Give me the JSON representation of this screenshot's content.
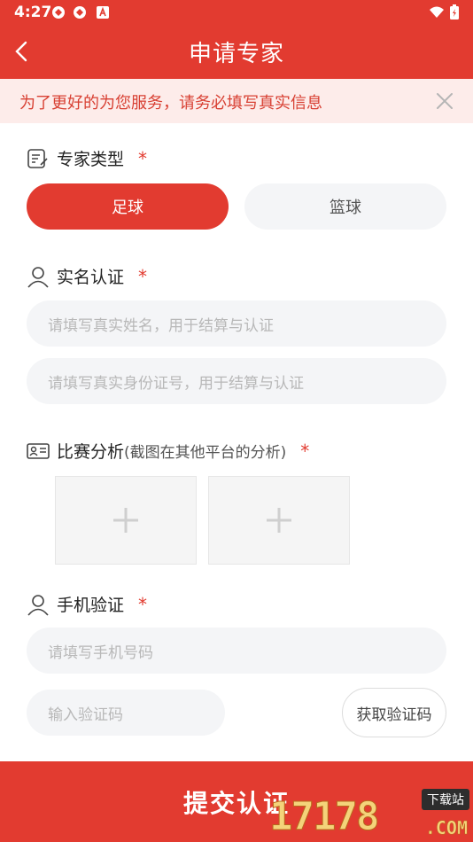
{
  "status_bar": {
    "time": "4:27"
  },
  "header": {
    "title": "申请专家"
  },
  "notice": {
    "text": "为了更好的为您服务，请务必填写真实信息"
  },
  "sections": {
    "expert_type": {
      "label": "专家类型",
      "required_mark": "*",
      "options": [
        "足球",
        "篮球"
      ],
      "selected": "足球"
    },
    "real_name": {
      "label": "实名认证",
      "required_mark": "*",
      "name_placeholder": "请填写真实姓名，用于结算与认证",
      "id_placeholder": "请填写真实身份证号，用于结算与认证"
    },
    "analysis": {
      "label": "比赛分析",
      "sub_label": "(截图在其他平台的分析)",
      "required_mark": "*"
    },
    "phone": {
      "label": "手机验证",
      "required_mark": "*",
      "phone_placeholder": "请填写手机号码",
      "code_placeholder": "输入验证码",
      "get_code_label": "获取验证码"
    }
  },
  "submit": {
    "label": "提交认证"
  },
  "watermark": {
    "number": "17178",
    "tag": "下载站",
    "suffix": ".COM"
  },
  "colors": {
    "accent": "#e23b30",
    "notice_bg": "#fdecea",
    "field_bg": "#f4f5f7"
  }
}
